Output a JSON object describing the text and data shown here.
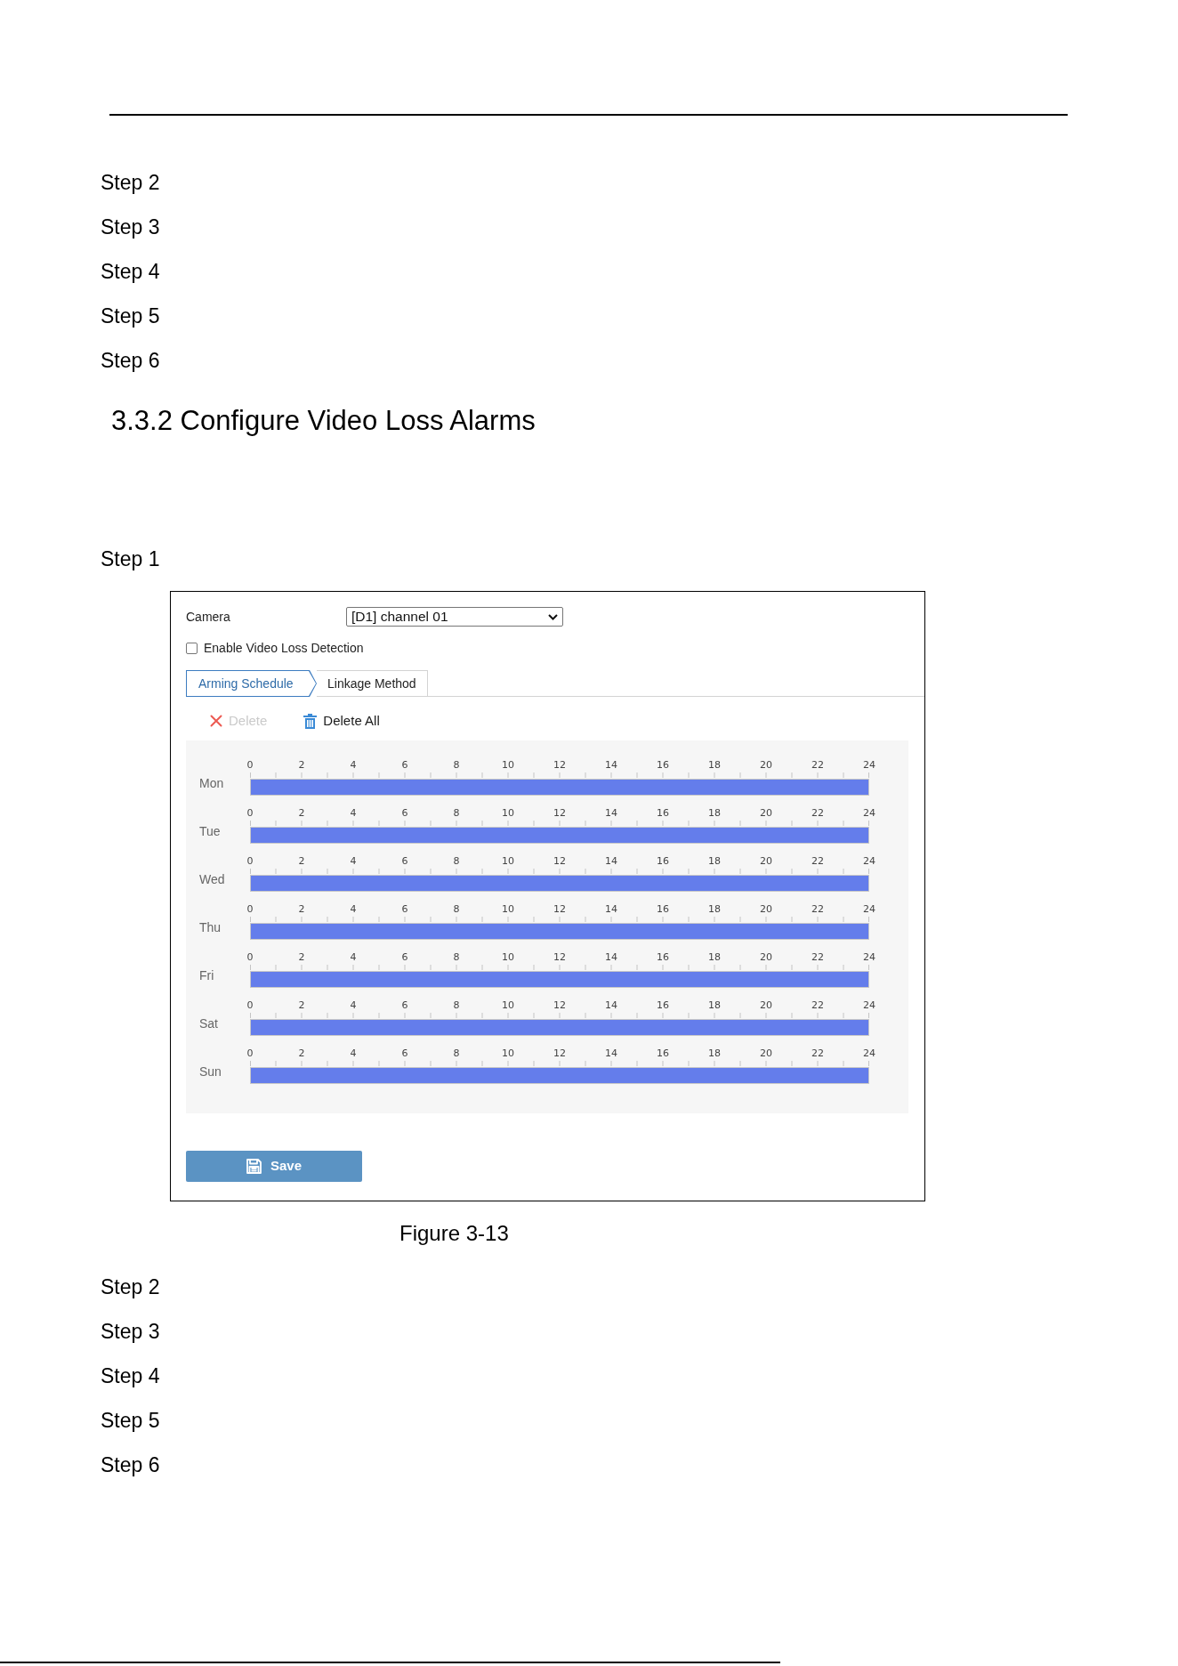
{
  "steps_top": [
    "Step 2",
    "Step 3",
    "Step 4",
    "Step 5",
    "Step 6"
  ],
  "section_heading": "3.3.2 Configure Video Loss Alarms",
  "step_intro": "Step 1",
  "figure": {
    "camera": {
      "label": "Camera",
      "value": "[D1] channel 01"
    },
    "enable": {
      "label": "Enable Video Loss Detection",
      "checked": false
    },
    "tabs": [
      {
        "label": "Arming Schedule",
        "selected": true
      },
      {
        "label": "Linkage Method",
        "selected": false
      }
    ],
    "actions": [
      {
        "kind": "delete",
        "label": "Delete",
        "disabled": true
      },
      {
        "kind": "clear",
        "label": "Delete All",
        "disabled": false
      }
    ],
    "schedule": [
      {
        "day": "Mon",
        "level": 1,
        "hours": [
          "0",
          "2",
          "4",
          "6",
          "8",
          "10",
          "12",
          "14",
          "16",
          "18",
          "20",
          "22",
          "24"
        ]
      },
      {
        "day": "Tue",
        "level": 1,
        "hours": [
          "0",
          "2",
          "4",
          "6",
          "8",
          "10",
          "12",
          "14",
          "16",
          "18",
          "20",
          "22",
          "24"
        ]
      },
      {
        "day": "Wed",
        "level": 1,
        "hours": [
          "0",
          "2",
          "4",
          "6",
          "8",
          "10",
          "12",
          "14",
          "16",
          "18",
          "20",
          "22",
          "24"
        ]
      },
      {
        "day": "Thu",
        "level": 1,
        "hours": [
          "0",
          "2",
          "4",
          "6",
          "8",
          "10",
          "12",
          "14",
          "16",
          "18",
          "20",
          "22",
          "24"
        ]
      },
      {
        "day": "Fri",
        "level": 1,
        "hours": [
          "0",
          "2",
          "4",
          "6",
          "8",
          "10",
          "12",
          "14",
          "16",
          "18",
          "20",
          "22",
          "24"
        ]
      },
      {
        "day": "Sat",
        "level": 1,
        "hours": [
          "0",
          "2",
          "4",
          "6",
          "8",
          "10",
          "12",
          "14",
          "16",
          "18",
          "20",
          "22",
          "24"
        ]
      },
      {
        "day": "Sun",
        "level": 1,
        "hours": [
          "0",
          "2",
          "4",
          "6",
          "8",
          "10",
          "12",
          "14",
          "16",
          "18",
          "20",
          "22",
          "24"
        ]
      }
    ],
    "save_button": "Save"
  },
  "caption": "Figure 3-13",
  "steps_bottom": [
    "Step 2",
    "Step 3",
    "Step 4",
    "Step 5",
    "Step 6"
  ]
}
